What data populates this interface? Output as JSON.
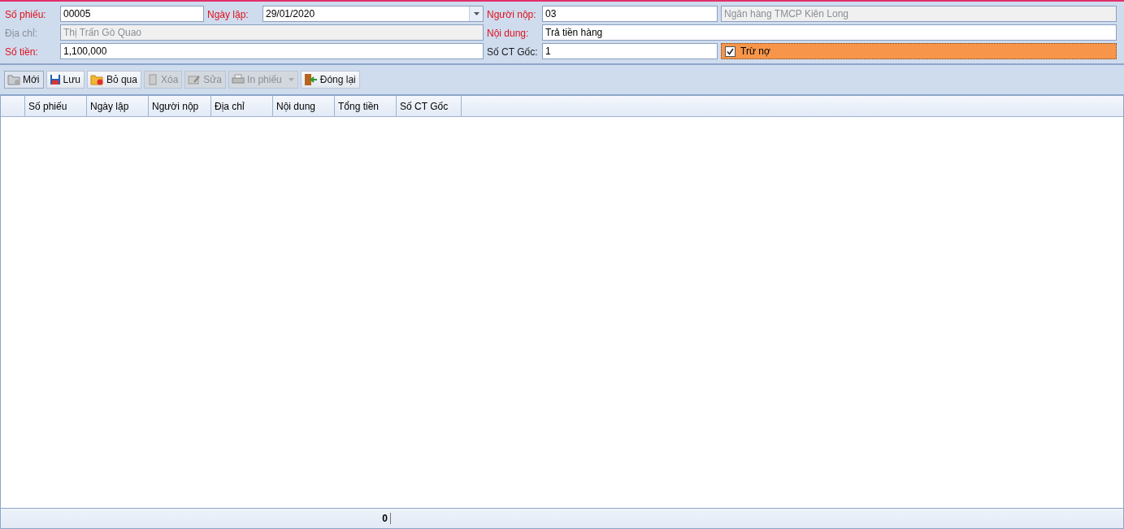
{
  "form": {
    "fields": [
      {
        "label": "Số phiếu:",
        "value": "00005",
        "required": true,
        "disabled": false,
        "kind": "text"
      },
      {
        "label": "Ngày lập:",
        "value": "29/01/2020",
        "required": true,
        "disabled": false,
        "kind": "date"
      },
      {
        "label": "Người nộp:",
        "value": "03",
        "required": true,
        "disabled": false,
        "kind": "text"
      },
      {
        "value": "Ngân hàng TMCP Kiên Long",
        "disabled": true,
        "kind": "text"
      },
      {
        "label": "Địa chỉ:",
        "value": "Thị Trấn Gò Quao",
        "required": false,
        "disabled": true,
        "kind": "text"
      },
      {
        "label": "Nội dung:",
        "value": "Trả tiền hàng",
        "required": true,
        "disabled": false,
        "kind": "text"
      },
      {
        "label": "Số tiền:",
        "value": "1,100,000",
        "required": true,
        "disabled": false,
        "kind": "text"
      },
      {
        "label": "Số CT Gốc:",
        "value": "1",
        "required": false,
        "disabled": false,
        "kind": "text"
      },
      {
        "label": "Trừ nợ",
        "checked": true,
        "kind": "checkbox"
      }
    ]
  },
  "toolbar": [
    {
      "label": "Mới",
      "disabled": false,
      "pressed": true,
      "kind": "button"
    },
    {
      "label": "Lưu",
      "disabled": false,
      "pressed": false,
      "kind": "button"
    },
    {
      "label": "Bỏ qua",
      "disabled": false,
      "pressed": false,
      "kind": "button"
    },
    {
      "label": "Xóa",
      "disabled": true,
      "pressed": false,
      "kind": "button"
    },
    {
      "label": "Sửa",
      "disabled": true,
      "pressed": false,
      "kind": "button"
    },
    {
      "label": "In phiếu",
      "disabled": true,
      "pressed": false,
      "kind": "dropdown"
    },
    {
      "label": "Đóng lại",
      "disabled": false,
      "pressed": false,
      "kind": "button"
    }
  ],
  "table": {
    "columns": [
      "Số phiếu",
      "Ngày lập",
      "Người nộp",
      "Địa chỉ",
      "Nội dung",
      "Tổng tiền",
      "Số CT Gốc"
    ]
  },
  "status_bar": {
    "total": "0"
  }
}
